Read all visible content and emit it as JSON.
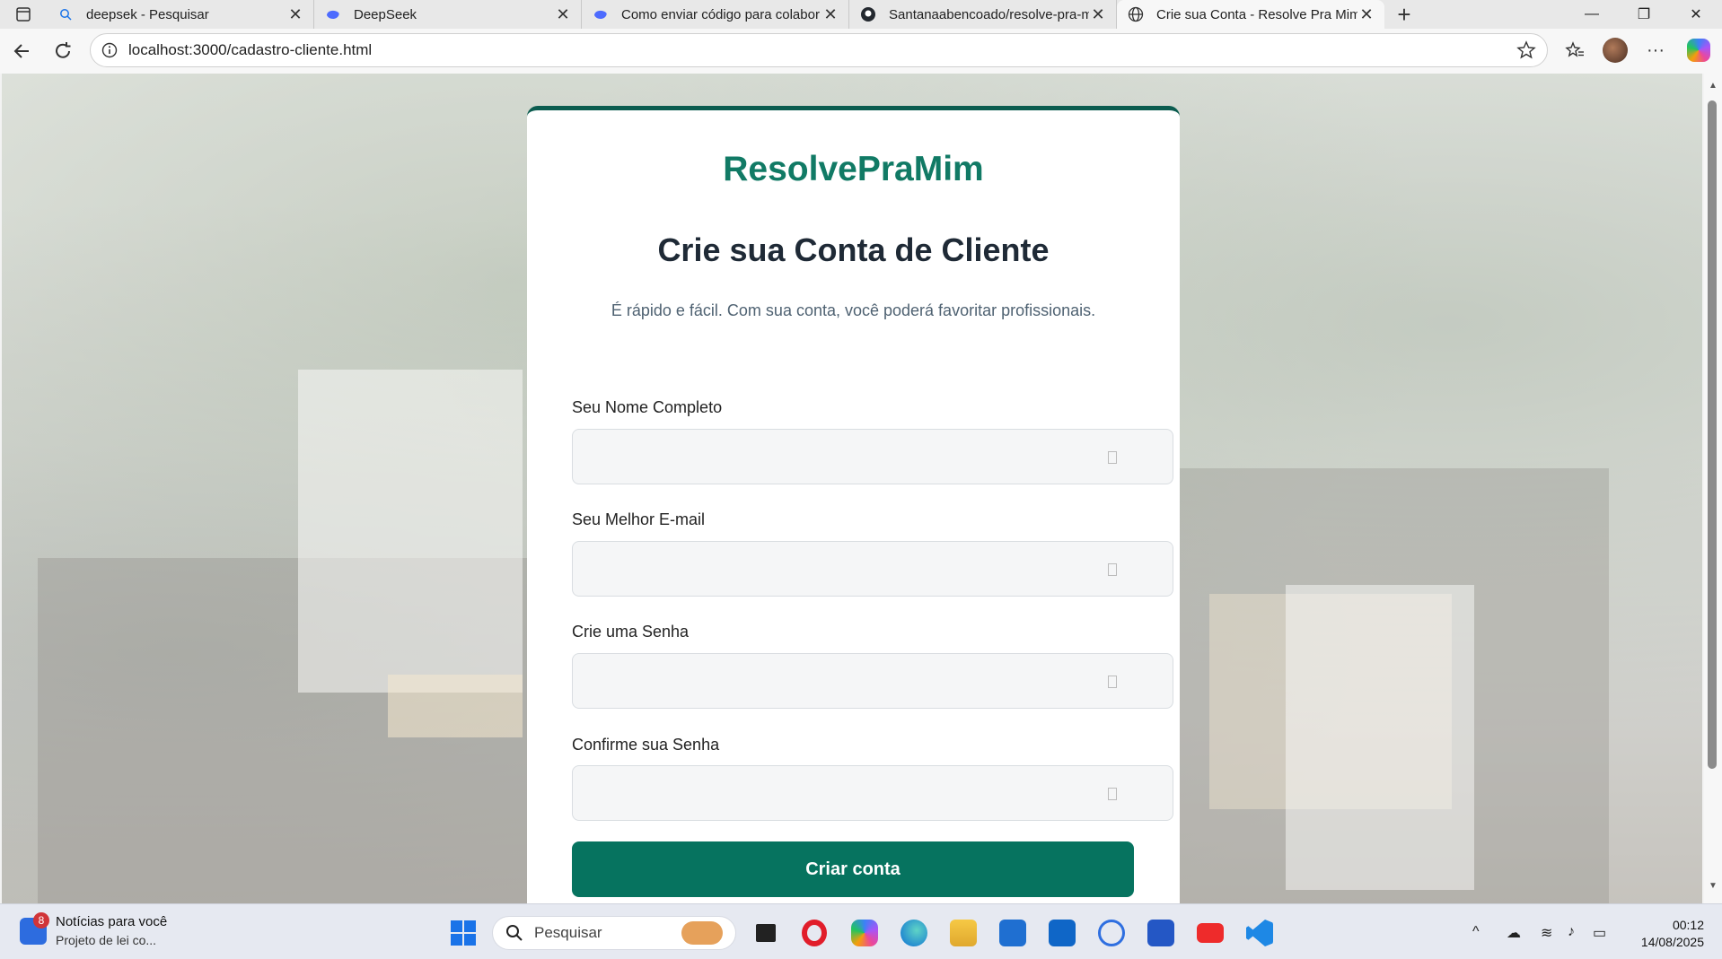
{
  "browser": {
    "tabs": [
      {
        "title": "deepsek - Pesquisar",
        "icon": "search-icon"
      },
      {
        "title": "DeepSeek",
        "icon": "deepseek-icon"
      },
      {
        "title": "Como enviar código para colabor",
        "icon": "deepseek-icon"
      },
      {
        "title": "Santanaabencoado/resolve-pra-m",
        "icon": "github-icon"
      },
      {
        "title": "Crie sua Conta - Resolve Pra Mim",
        "icon": "globe-icon",
        "active": true
      }
    ],
    "url": "localhost:3000/cadastro-cliente.html"
  },
  "page": {
    "brand": "ResolvePraMim",
    "heading": "Crie sua Conta de Cliente",
    "subtitle": "É rápido e fácil. Com sua conta, você poderá favoritar profissionais.",
    "fields": [
      {
        "label": "Seu Nome Completo",
        "value": ""
      },
      {
        "label": "Seu Melhor E-mail",
        "value": ""
      },
      {
        "label": "Crie uma Senha",
        "value": ""
      },
      {
        "label": "Confirme sua Senha",
        "value": ""
      }
    ],
    "submit_label": "Criar conta",
    "colors": {
      "brand": "#117a65",
      "button": "#06735f",
      "card_top": "#0b5c4f"
    }
  },
  "taskbar": {
    "news_title": "Notícias para você",
    "news_subtitle": "Projeto de lei co...",
    "news_badge": "8",
    "search_placeholder": "Pesquisar",
    "time": "00:12",
    "date": "14/08/2025"
  }
}
